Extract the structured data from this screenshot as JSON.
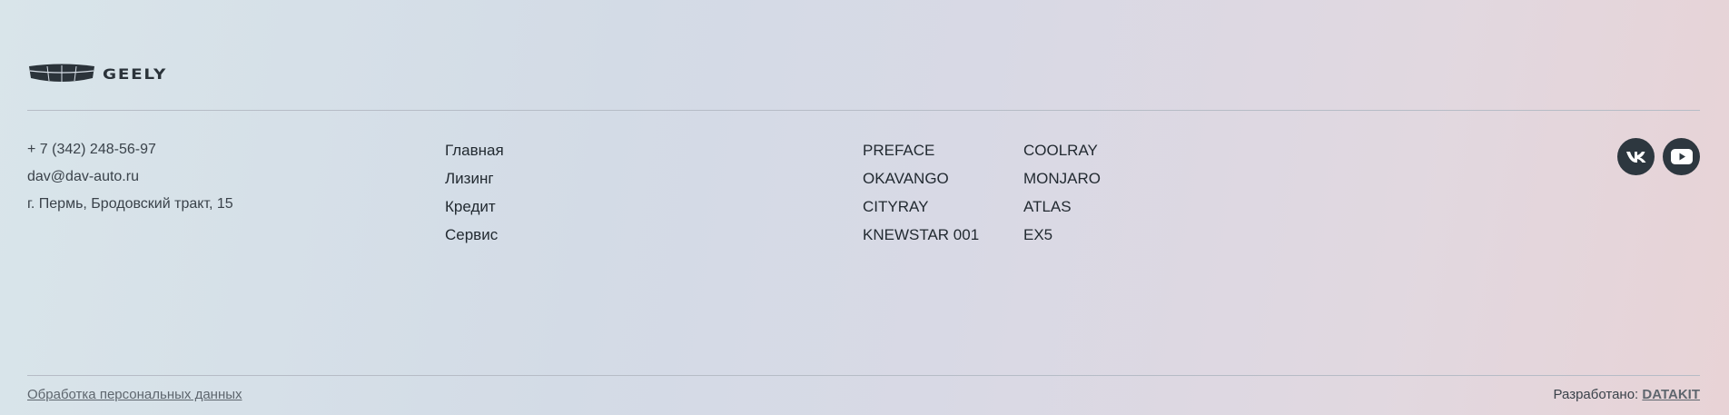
{
  "brand": {
    "logo_text": "GEELY",
    "logo_icon": "geely-grille-icon",
    "color": "#2b333a"
  },
  "contacts": {
    "phone": "+ 7 (342) 248-56-97",
    "email": "dav@dav-auto.ru",
    "address": "г. Пермь, Бродовский тракт, 15"
  },
  "nav": {
    "items": [
      {
        "label": "Главная"
      },
      {
        "label": "Лизинг"
      },
      {
        "label": "Кредит"
      },
      {
        "label": "Сервис"
      }
    ]
  },
  "models": {
    "column1": [
      {
        "label": "PREFACE"
      },
      {
        "label": "OKAVANGO"
      },
      {
        "label": "CITYRAY"
      },
      {
        "label": "KNEWSTAR 001"
      }
    ],
    "column2": [
      {
        "label": "COOLRAY"
      },
      {
        "label": "MONJARO"
      },
      {
        "label": "ATLAS"
      },
      {
        "label": "EX5"
      }
    ]
  },
  "socials": [
    {
      "name": "vk",
      "icon": "vk-icon"
    },
    {
      "name": "youtube",
      "icon": "youtube-icon"
    }
  ],
  "footer_bottom": {
    "privacy_link": "Обработка персональных данных",
    "developed_by_label": "Разработано:",
    "developer_name": "DATAKIT"
  },
  "colors": {
    "social_bg": "#2d373f",
    "divider": "#b6bcc6"
  }
}
